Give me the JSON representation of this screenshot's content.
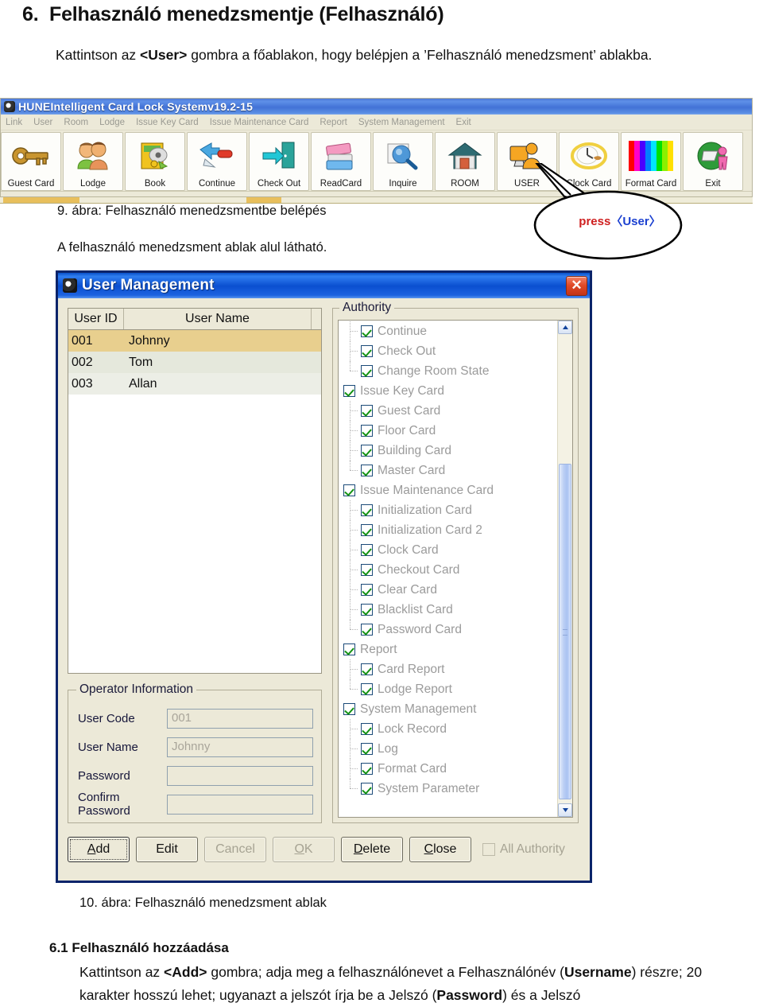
{
  "document": {
    "heading_number": "6.",
    "heading_text": "Felhasználó menedzsmentje (Felhasználó)",
    "intro_1": "Kattintson az ",
    "intro_bold": "<User>",
    "intro_2": " gombra a főablakon, hogy belépjen a ’Felhasználó menedzsment’ ablakba.",
    "figure9_caption": "9. ábra: Felhasználó menedzsmentbe belépés",
    "figure9_follow": "A felhasználó menedzsment ablak alul látható.",
    "figure10_caption": "10. ábra: Felhasználó menedzsment ablak",
    "section_number": "6.1",
    "section_title": "Felhasználó hozzáadása",
    "body_a1": "Kattintson az ",
    "body_b1": "<Add>",
    "body_a2": " gombra; adja meg a felhasználónevet a Felhasználónév (",
    "body_b2": "Username",
    "body_a3": ") részre; 20 karakter hosszú lehet; ugyanazt a jelszót írja be a Jelszó (",
    "body_b3": "Password",
    "body_a4": ") és a Jelszó"
  },
  "callout": {
    "prefix": "press",
    "target": "〈User〉"
  },
  "app_window": {
    "title": "HUNEIntelligent Card Lock Systemv19.2-15",
    "logo_icon": "app-logo-icon",
    "menu": [
      "Link",
      "User",
      "Room",
      "Lodge",
      "Issue Key Card",
      "Issue Maintenance Card",
      "Report",
      "System Management",
      "Exit"
    ],
    "toolbar": [
      {
        "label": "Guest Card",
        "icon": "key-icon"
      },
      {
        "label": "Lodge",
        "icon": "people-icon"
      },
      {
        "label": "Book",
        "icon": "book-icon"
      },
      {
        "label": "Continue",
        "icon": "arrow-tool-icon"
      },
      {
        "label": "Check Out",
        "icon": "exit-door-icon"
      },
      {
        "label": "ReadCard",
        "icon": "cards-icon"
      },
      {
        "label": "Inquire",
        "icon": "magnifier-icon"
      },
      {
        "label": "ROOM",
        "icon": "house-icon"
      },
      {
        "label": "USER",
        "icon": "user-monitor-icon"
      },
      {
        "label": "Clock Card",
        "icon": "clock-icon"
      },
      {
        "label": "Format Card",
        "icon": "color-bars-icon"
      },
      {
        "label": "Exit",
        "icon": "exit-person-icon"
      }
    ]
  },
  "dialog": {
    "title": "User Management",
    "title_icon": "app-logo-icon",
    "close_label": "✕",
    "user_list": {
      "columns": [
        "User ID",
        "User Name"
      ],
      "rows": [
        {
          "id": "001",
          "name": "Johnny"
        },
        {
          "id": "002",
          "name": "Tom"
        },
        {
          "id": "003",
          "name": "Allan"
        }
      ]
    },
    "operator_information": {
      "legend": "Operator Information",
      "fields": [
        {
          "label": "User Code",
          "value": "001"
        },
        {
          "label": "User Name",
          "value": "Johnny"
        },
        {
          "label": "Password",
          "value": ""
        },
        {
          "label": "Confirm Password",
          "value": ""
        }
      ]
    },
    "authority": {
      "legend": "Authority",
      "items": [
        {
          "label": "Continue",
          "level": 1,
          "checked": true
        },
        {
          "label": "Check Out",
          "level": 1,
          "checked": true
        },
        {
          "label": "Change Room State",
          "level": 1,
          "checked": true,
          "last": true
        },
        {
          "label": "Issue Key Card",
          "level": 0,
          "checked": true
        },
        {
          "label": "Guest Card",
          "level": 1,
          "checked": true
        },
        {
          "label": "Floor Card",
          "level": 1,
          "checked": true
        },
        {
          "label": "Building Card",
          "level": 1,
          "checked": true
        },
        {
          "label": "Master Card",
          "level": 1,
          "checked": true,
          "last": true
        },
        {
          "label": "Issue Maintenance Card",
          "level": 0,
          "checked": true
        },
        {
          "label": "Initialization Card",
          "level": 1,
          "checked": true
        },
        {
          "label": "Initialization Card 2",
          "level": 1,
          "checked": true
        },
        {
          "label": "Clock Card",
          "level": 1,
          "checked": true
        },
        {
          "label": "Checkout Card",
          "level": 1,
          "checked": true
        },
        {
          "label": "Clear Card",
          "level": 1,
          "checked": true
        },
        {
          "label": "Blacklist Card",
          "level": 1,
          "checked": true
        },
        {
          "label": "Password Card",
          "level": 1,
          "checked": true,
          "last": true
        },
        {
          "label": "Report",
          "level": 0,
          "checked": true
        },
        {
          "label": "Card Report",
          "level": 1,
          "checked": true
        },
        {
          "label": "Lodge Report",
          "level": 1,
          "checked": true,
          "last": true
        },
        {
          "label": "System Management",
          "level": 0,
          "checked": true
        },
        {
          "label": "Lock Record",
          "level": 1,
          "checked": true
        },
        {
          "label": "Log",
          "level": 1,
          "checked": true
        },
        {
          "label": "Format Card",
          "level": 1,
          "checked": true
        },
        {
          "label": "System Parameter",
          "level": 1,
          "checked": true,
          "last": true
        }
      ],
      "scroll_up_icon": "chevron-up-icon",
      "scroll_down_icon": "chevron-down-icon"
    },
    "buttons": [
      {
        "label": "Add",
        "accel": "A",
        "state": "focused"
      },
      {
        "label": "Edit",
        "accel": "",
        "state": "enabled"
      },
      {
        "label": "Cancel",
        "accel": "",
        "state": "disabled"
      },
      {
        "label": "OK",
        "accel": "O",
        "state": "disabled"
      },
      {
        "label": "Delete",
        "accel": "D",
        "state": "enabled"
      },
      {
        "label": "Close",
        "accel": "C",
        "state": "enabled"
      }
    ],
    "all_authority_label": "All Authority",
    "all_authority_checked": false
  },
  "colors": {
    "title_blue": "#0a4fd0",
    "dialog_face": "#ece9d8",
    "selected_row": "#e8cf8e",
    "callout_red": "#cf2020",
    "callout_blue": "#1a3fd0",
    "check_green": "#139213"
  }
}
